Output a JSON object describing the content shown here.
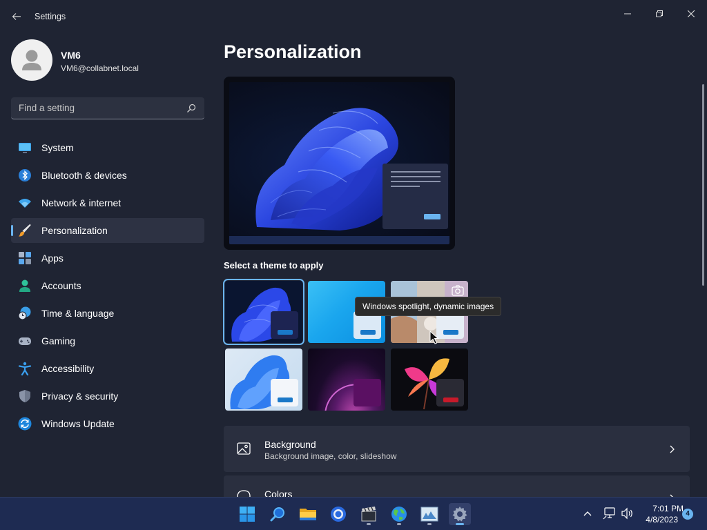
{
  "window": {
    "title": "Settings",
    "back_icon": "back-arrow-icon",
    "controls": [
      "minimize-icon",
      "maximize-icon",
      "close-icon"
    ]
  },
  "profile": {
    "name": "VM6",
    "email": "VM6@collabnet.local",
    "avatar_icon": "user-avatar-icon"
  },
  "search": {
    "placeholder": "Find a setting",
    "icon": "search-icon"
  },
  "sidebar": {
    "items": [
      {
        "label": "System",
        "icon": "monitor-icon",
        "active": false
      },
      {
        "label": "Bluetooth & devices",
        "icon": "bluetooth-icon",
        "active": false
      },
      {
        "label": "Network & internet",
        "icon": "wifi-icon",
        "active": false
      },
      {
        "label": "Personalization",
        "icon": "brush-icon",
        "active": true
      },
      {
        "label": "Apps",
        "icon": "apps-icon",
        "active": false
      },
      {
        "label": "Accounts",
        "icon": "person-icon",
        "active": false
      },
      {
        "label": "Time & language",
        "icon": "globe-clock-icon",
        "active": false
      },
      {
        "label": "Gaming",
        "icon": "gamepad-icon",
        "active": false
      },
      {
        "label": "Accessibility",
        "icon": "accessibility-icon",
        "active": false
      },
      {
        "label": "Privacy & security",
        "icon": "shield-icon",
        "active": false
      },
      {
        "label": "Windows Update",
        "icon": "update-icon",
        "active": false
      }
    ]
  },
  "main": {
    "title": "Personalization",
    "theme_heading": "Select a theme to apply",
    "themes": [
      {
        "name": "windows-dark",
        "selected": true,
        "button_color": "#1a78c8"
      },
      {
        "name": "glow",
        "selected": false,
        "button_color": "#1a78c8"
      },
      {
        "name": "windows-spotlight",
        "selected": false,
        "button_color": "#1a78c8"
      },
      {
        "name": "windows-light",
        "selected": false,
        "button_color": "#1a78c8"
      },
      {
        "name": "captured-motion",
        "selected": false,
        "button_color": "#7a1a7a"
      },
      {
        "name": "flow",
        "selected": false,
        "button_color": "#c81a2a"
      }
    ],
    "tooltip": "Windows spotlight, dynamic images",
    "cards": [
      {
        "title": "Background",
        "subtitle": "Background image, color, slideshow",
        "icon": "image-icon"
      },
      {
        "title": "Colors",
        "subtitle": "",
        "icon": "palette-icon"
      }
    ]
  },
  "taskbar": {
    "apps": [
      {
        "name": "start",
        "icon": "windows-start-icon",
        "running": false,
        "active": false
      },
      {
        "name": "search",
        "icon": "search-icon",
        "running": false,
        "active": false
      },
      {
        "name": "file-explorer",
        "icon": "folder-icon",
        "running": false,
        "active": false
      },
      {
        "name": "chrome",
        "icon": "chrome-icon",
        "running": false,
        "active": false
      },
      {
        "name": "media-player",
        "icon": "clapperboard-icon",
        "running": true,
        "active": false
      },
      {
        "name": "maps",
        "icon": "globe-icon",
        "running": true,
        "active": false
      },
      {
        "name": "photos",
        "icon": "picture-icon",
        "running": true,
        "active": false
      },
      {
        "name": "settings",
        "icon": "gear-icon",
        "running": true,
        "active": true
      }
    ],
    "tray": {
      "time": "7:01 PM",
      "date": "4/8/2023",
      "notification_count": "4"
    }
  },
  "colors": {
    "accent": "#6ab4f0",
    "window_bg": "#1f2433",
    "card_bg": "#2a2f3f",
    "taskbar_bg": "#1e2b52"
  }
}
